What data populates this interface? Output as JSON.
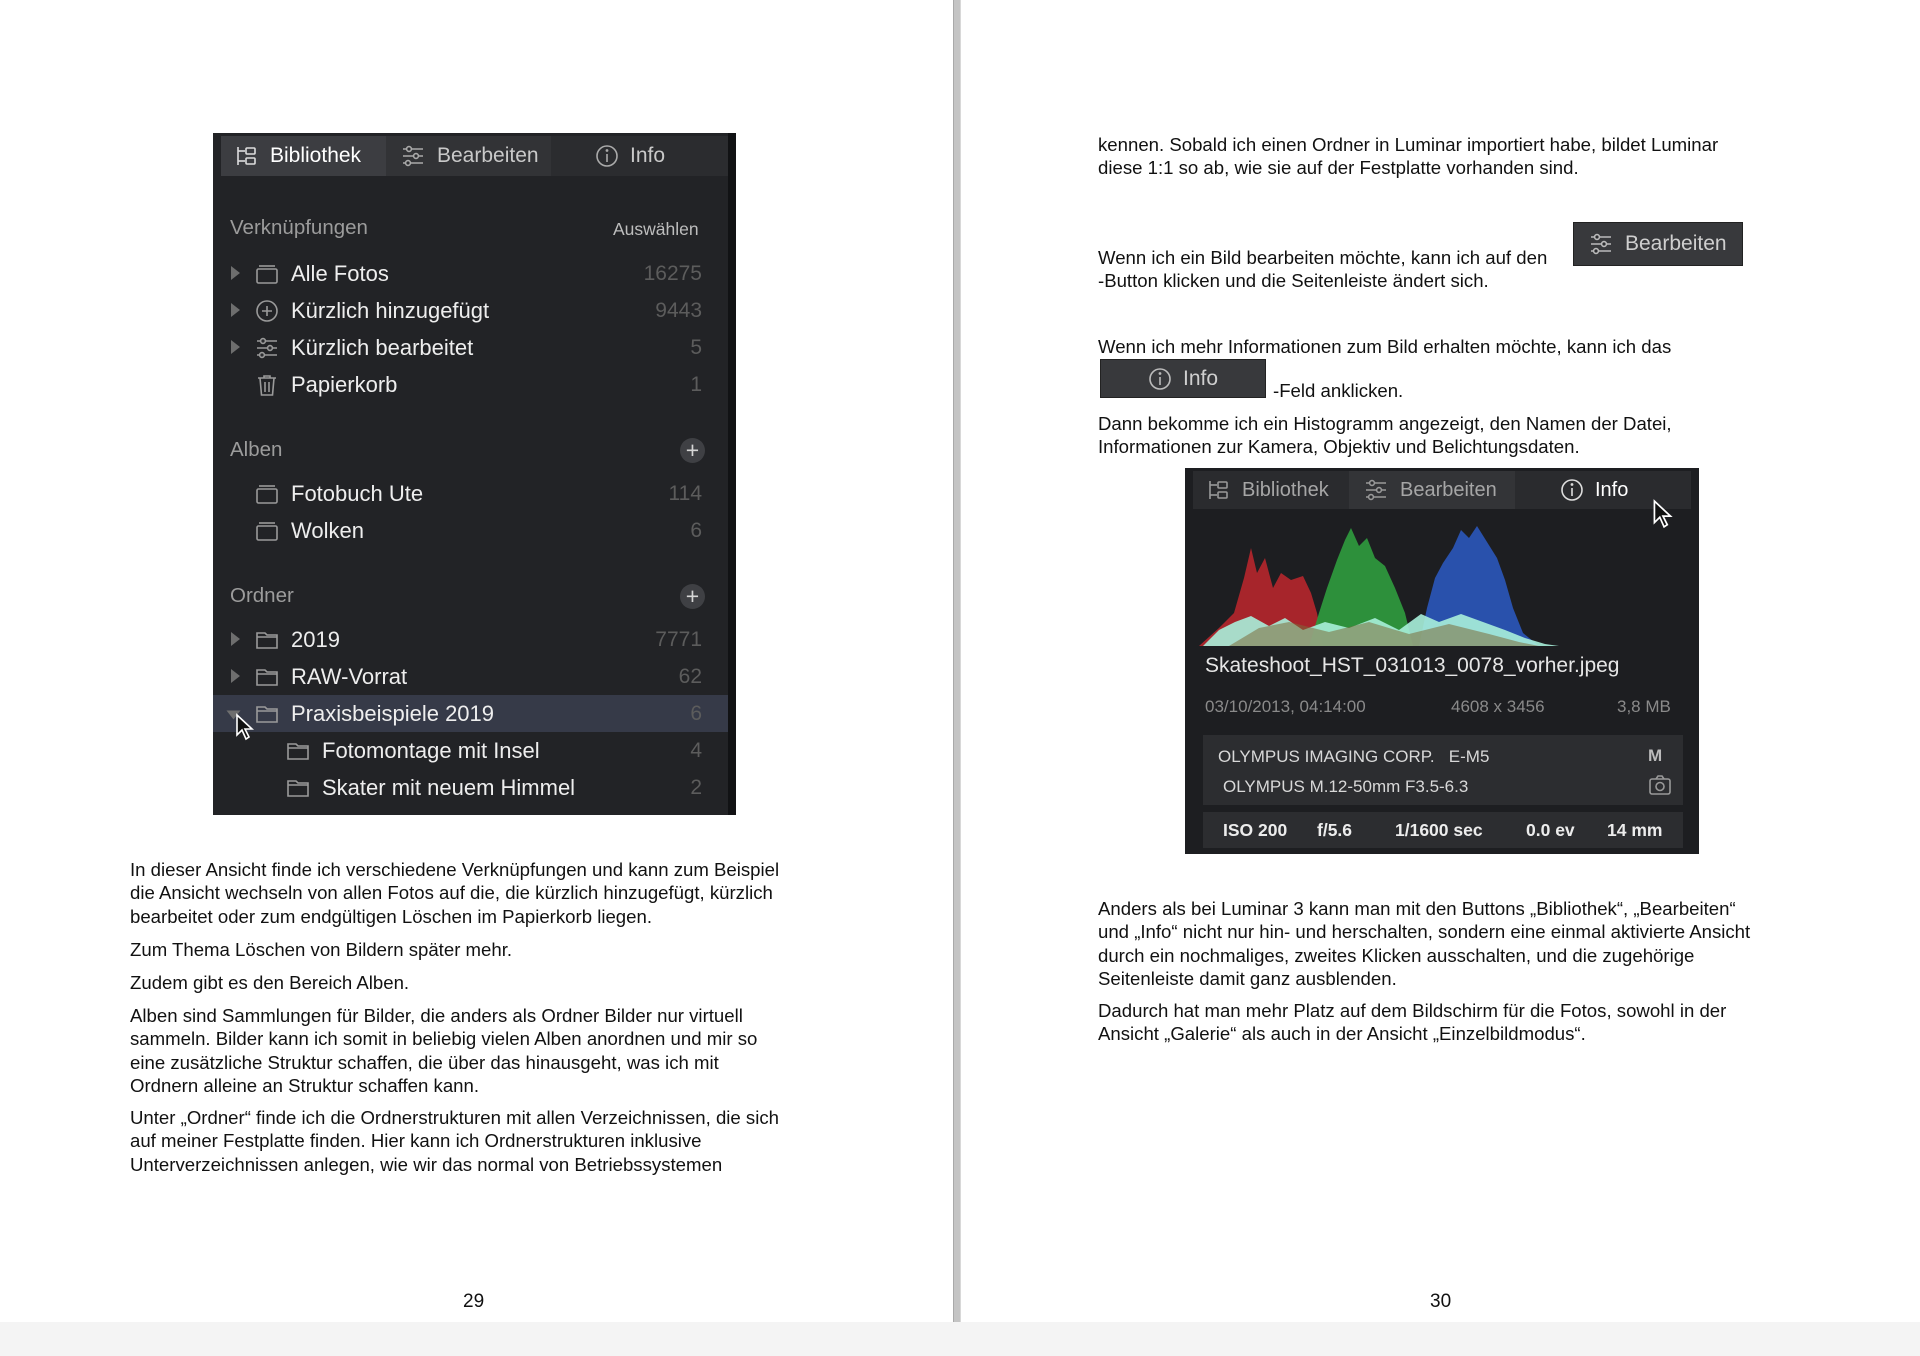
{
  "library_panel": {
    "tabs": [
      {
        "label": "Bibliothek",
        "icon": "library-icon"
      },
      {
        "label": "Bearbeiten",
        "icon": "sliders-icon"
      },
      {
        "label": "Info",
        "icon": "info-icon"
      }
    ],
    "shortcuts": {
      "heading": "Verknüpfungen",
      "action": "Auswählen",
      "items": [
        {
          "label": "Alle Fotos",
          "count": "16275",
          "icon": "photos-stack-icon"
        },
        {
          "label": "Kürzlich hinzugefügt",
          "count": "9443",
          "icon": "plus-circle-icon"
        },
        {
          "label": "Kürzlich bearbeitet",
          "count": "5",
          "icon": "sliders-icon"
        },
        {
          "label": "Papierkorb",
          "count": "1",
          "icon": "trash-icon"
        }
      ]
    },
    "albums": {
      "heading": "Alben",
      "add": "+",
      "items": [
        {
          "label": "Fotobuch Ute",
          "count": "114",
          "icon": "album-icon"
        },
        {
          "label": "Wolken",
          "count": "6",
          "icon": "album-icon"
        }
      ]
    },
    "folders": {
      "heading": "Ordner",
      "add": "+",
      "items": [
        {
          "label": "2019",
          "count": "7771",
          "icon": "folder-icon"
        },
        {
          "label": "RAW-Vorrat",
          "count": "62",
          "icon": "folder-icon"
        },
        {
          "label": "Praxisbeispiele 2019",
          "count": "6",
          "icon": "folder-icon",
          "selected": true
        },
        {
          "label": "Fotomontage mit Insel",
          "count": "4",
          "icon": "folder-icon"
        },
        {
          "label": "Skater mit neuem Himmel",
          "count": "2",
          "icon": "folder-icon"
        }
      ]
    }
  },
  "left_text": {
    "p1": [
      "In dieser Ansicht finde ich verschiedene Verknüpfungen und kann zum Beispiel",
      "die Ansicht wechseln von allen Fotos auf die, die kürzlich hinzugefügt, kürzlich",
      "bearbeitet oder zum endgültigen Löschen im Papierkorb liegen."
    ],
    "p2": "Zum Thema Löschen von Bildern später mehr.",
    "p3": "Zudem gibt es den Bereich Alben.",
    "p4": [
      "Alben sind Sammlungen für Bilder, die anders als Ordner Bilder nur virtuell",
      "sammeln. Bilder kann ich somit in beliebig vielen Alben anordnen und mir so",
      "eine zusätzliche Struktur schaffen, die über das hinausgeht, was ich mit",
      "Ordnern alleine an Struktur schaffen kann."
    ],
    "p5": [
      "Unter „Ordner“ finde ich die Ordnerstrukturen mit allen Verzeichnissen, die sich",
      "auf meiner Festplatte finden. Hier kann ich Ordnerstrukturen inklusive",
      "Unterverzeichnissen anlegen, wie wir das normal von Betriebssystemen"
    ],
    "page_number": "29"
  },
  "right_text": {
    "p1": [
      "kennen. Sobald ich einen Ordner in Luminar importiert habe, bildet Luminar",
      "diese 1:1 so ab, wie sie auf der Festplatte vorhanden sind."
    ],
    "p2_line1": "Wenn ich ein Bild bearbeiten möchte, kann ich auf den",
    "p2_line2": "-Button klicken und die Seitenleiste ändert sich.",
    "p3_line1": "Wenn ich mehr Informationen zum Bild erhalten möchte, kann ich das",
    "p3_after_button": "-Feld anklicken.",
    "p4": [
      "Dann bekomme ich ein Histogramm angezeigt, den Namen der Datei,",
      "Informationen zur Kamera, Objektiv und Belichtungsdaten."
    ],
    "p5": [
      "Anders als bei Luminar 3 kann man mit den Buttons „Bibliothek“, „Bearbeiten“",
      "und „Info“ nicht nur hin- und herschalten, sondern eine einmal aktivierte Ansicht",
      "durch ein nochmaliges, zweites Klicken ausschalten, und die zugehörige",
      "Seitenleiste damit ganz ausblenden."
    ],
    "p6": [
      "Dadurch hat man mehr Platz auf dem Bildschirm für die Fotos, sowohl in der",
      "Ansicht „Galerie“ als auch in der Ansicht „Einzelbildmodus“."
    ],
    "page_number": "30"
  },
  "inline_buttons": {
    "edit": {
      "label": "Bearbeiten",
      "icon": "sliders-icon"
    },
    "info": {
      "label": "Info",
      "icon": "info-icon"
    }
  },
  "info_panel": {
    "tabs": [
      {
        "label": "Bibliothek",
        "icon": "library-icon"
      },
      {
        "label": "Bearbeiten",
        "icon": "sliders-icon"
      },
      {
        "label": "Info",
        "icon": "info-icon"
      }
    ],
    "filename": "Skateshoot_HST_031013_0078_vorher.jpeg",
    "date": "03/10/2013, 04:14:00",
    "dimensions": "4608 x 3456",
    "filesize": "3,8 MB",
    "camera": "OLYMPUS IMAGING CORP.   E-M5",
    "lens": "OLYMPUS M.12-50mm F3.5-6.3",
    "mode": "M",
    "exposure": {
      "iso": "ISO 200",
      "aperture": "f/5.6",
      "shutter": "1/1600 sec",
      "ev": "0.0 ev",
      "focal": "14 mm"
    }
  },
  "colors": {
    "panel_bg": "#222326",
    "tab_bar": "#2b2c2f",
    "tab_active": "#3c3d41",
    "selected_row": "#363a48",
    "hist_red": "#b3262c",
    "hist_green": "#2f9a3e",
    "hist_blue": "#2a56b8",
    "hist_cyan": "#a8f0da"
  }
}
